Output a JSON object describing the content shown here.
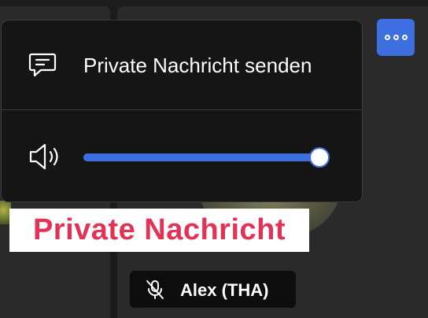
{
  "menu": {
    "private_message_label": "Private Nachricht senden",
    "volume_level": 0.96
  },
  "caption": {
    "text": "Private Nachricht"
  },
  "participant": {
    "name": "Alex (THA)",
    "muted": true
  },
  "colors": {
    "accent": "#3d6fe0",
    "caption_text": "#e23357",
    "menu_bg": "#151515"
  },
  "icons": {
    "more": "more-options-icon",
    "message": "chat-bubble-icon",
    "volume": "speaker-icon",
    "mute": "microphone-muted-icon"
  }
}
